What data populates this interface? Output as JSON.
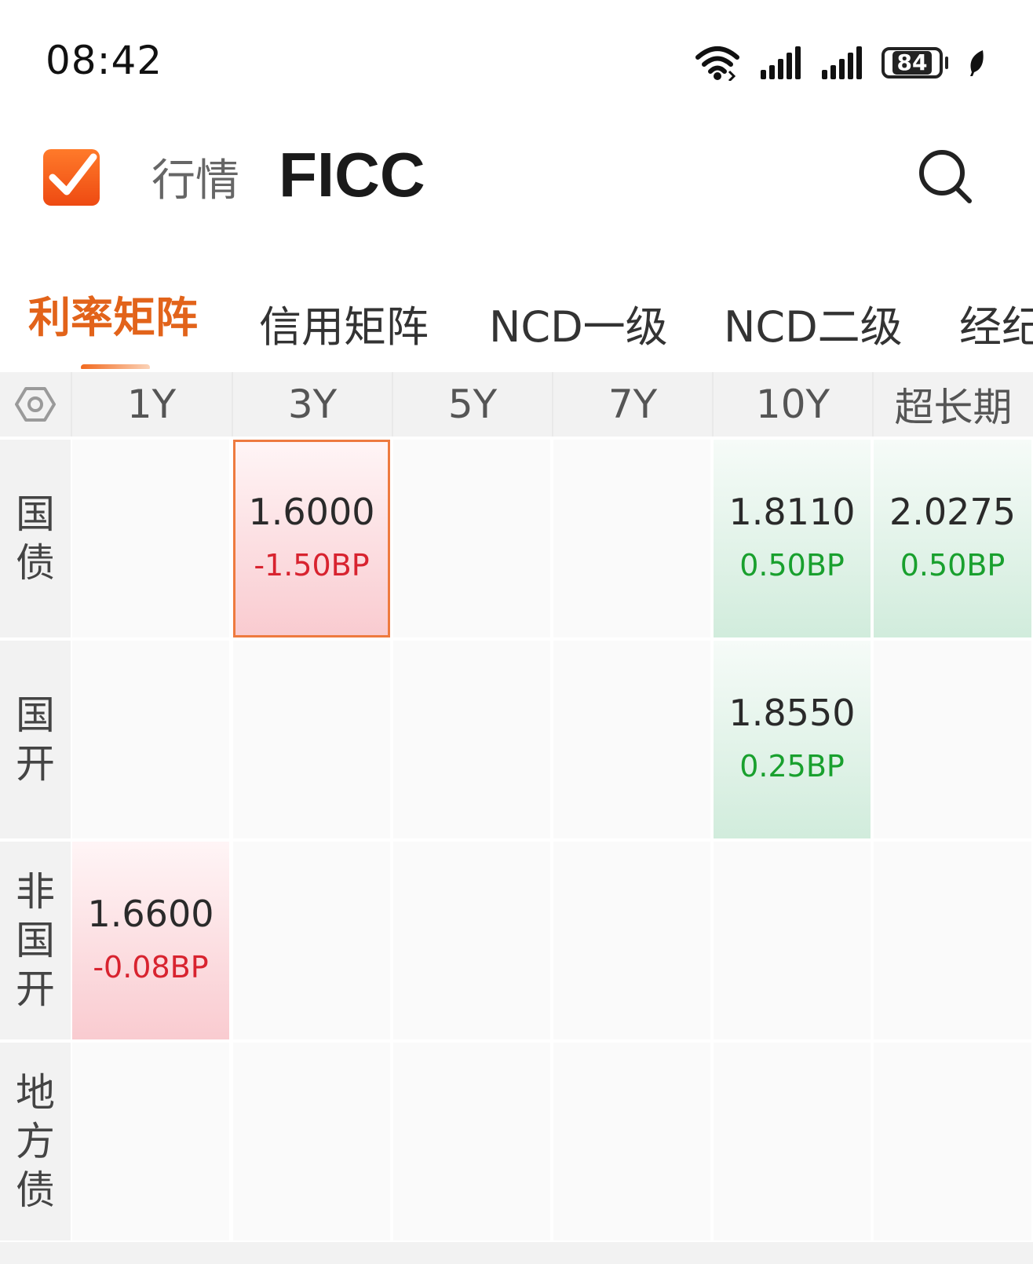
{
  "status_bar": {
    "time": "08:42",
    "battery": "84",
    "icons": [
      "wifi-icon",
      "signal-icon",
      "signal-icon",
      "battery-icon",
      "leaf-icon"
    ]
  },
  "header": {
    "subtitle": "行情",
    "title": "FICC",
    "logo_icon": "checkmark-logo-icon",
    "search_icon": "search-icon"
  },
  "tabs": [
    {
      "label": "利率矩阵",
      "active": true
    },
    {
      "label": "信用矩阵",
      "active": false
    },
    {
      "label": "NCD一级",
      "active": false
    },
    {
      "label": "NCD二级",
      "active": false
    },
    {
      "label": "经纪",
      "active": false
    }
  ],
  "matrix": {
    "settings_icon": "hexagon-settings-icon",
    "columns": [
      "1Y",
      "3Y",
      "5Y",
      "7Y",
      "10Y",
      "超长期"
    ],
    "rows": [
      {
        "label": "国债",
        "cells": [
          null,
          {
            "value": "1.6000",
            "change": "-1.50BP",
            "trend": "down",
            "selected": true
          },
          null,
          null,
          {
            "value": "1.8110",
            "change": "0.50BP",
            "trend": "up"
          },
          {
            "value": "2.0275",
            "change": "0.50BP",
            "trend": "up"
          }
        ]
      },
      {
        "label": "国开",
        "cells": [
          null,
          null,
          null,
          null,
          {
            "value": "1.8550",
            "change": "0.25BP",
            "trend": "up"
          },
          null
        ]
      },
      {
        "label": "非国开",
        "cells": [
          {
            "value": "1.6600",
            "change": "-0.08BP",
            "trend": "down"
          },
          null,
          null,
          null,
          null,
          null
        ]
      },
      {
        "label": "地方债",
        "cells": [
          null,
          null,
          null,
          null,
          null,
          null
        ]
      }
    ]
  },
  "colors": {
    "accent": "#e2631a",
    "down": "#d8232f",
    "up": "#19a02e"
  }
}
